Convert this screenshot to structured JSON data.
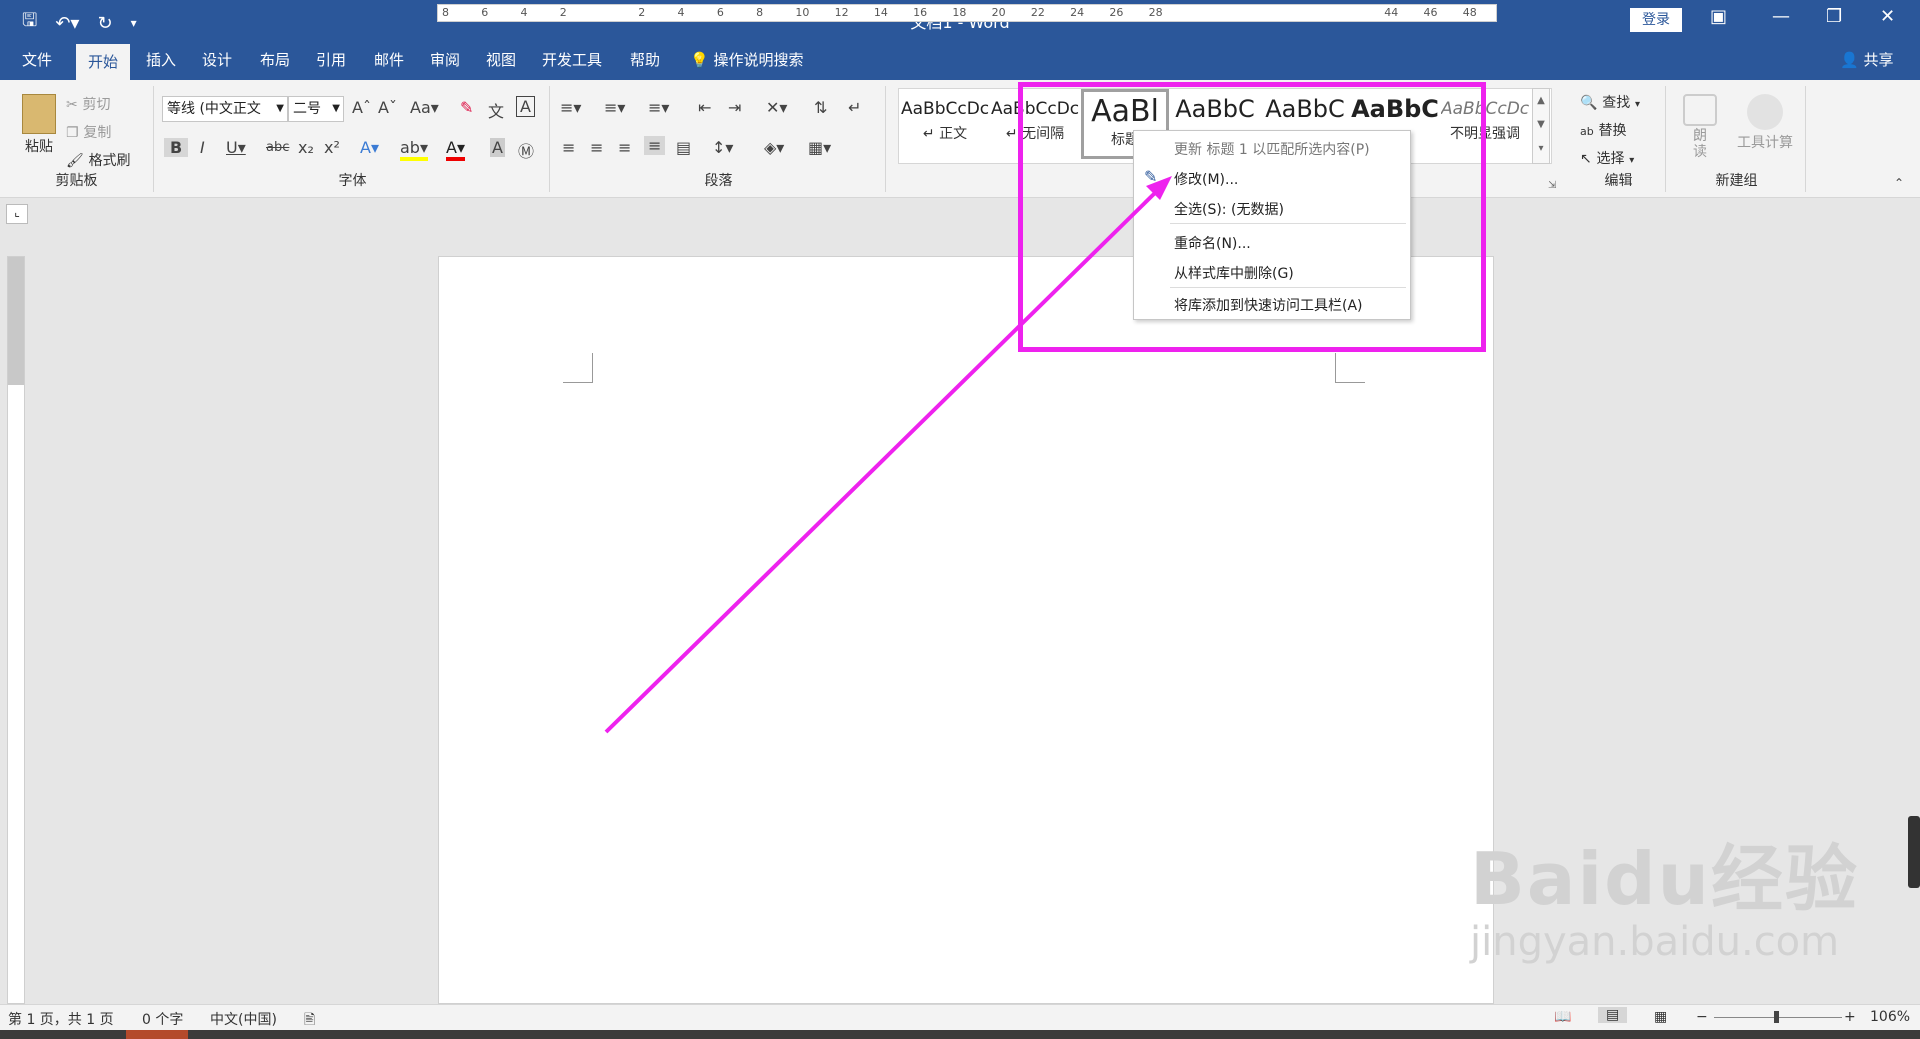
{
  "titlebar": {
    "title": "文档1  -  Word",
    "login": "登录"
  },
  "tabs": [
    "文件",
    "开始",
    "插入",
    "设计",
    "布局",
    "引用",
    "邮件",
    "审阅",
    "视图",
    "开发工具",
    "帮助"
  ],
  "search_tab": "操作说明搜索",
  "share": "共享",
  "clipboard": {
    "paste": "粘贴",
    "cut": "剪切",
    "copy": "复制",
    "format_painter": "格式刷",
    "label": "剪贴板"
  },
  "font": {
    "name": "等线 (中文正文",
    "size": "二号",
    "label": "字体"
  },
  "paragraph": {
    "label": "段落"
  },
  "styles": [
    {
      "preview": "AaBbCcDc",
      "name": "↵ 正文"
    },
    {
      "preview": "AaBbCcDc",
      "name": "↵ 无间隔"
    },
    {
      "preview": "AaBl",
      "name": "标题"
    },
    {
      "preview": "AaBbC",
      "name": ""
    },
    {
      "preview": "AaBbC",
      "name": ""
    },
    {
      "preview": "AaBbC",
      "name": "题"
    },
    {
      "preview": "AaBbCcDc",
      "name": "不明显强调"
    }
  ],
  "editing": {
    "find": "查找",
    "replace": "替换",
    "select": "选择",
    "label": "编辑"
  },
  "newgroup": {
    "read": "朗读",
    "calc": "工具计算",
    "label": "新建组"
  },
  "ruler": {
    "labels": [
      "8",
      "6",
      "4",
      "2",
      "",
      "2",
      "4",
      "6",
      "8",
      "10",
      "12",
      "14",
      "16",
      "18",
      "20",
      "22",
      "24",
      "26",
      "28",
      "",
      "",
      "",
      "",
      "",
      "44",
      "46",
      "48"
    ]
  },
  "context_menu": {
    "items": [
      "更新 标题 1 以匹配所选内容(P)",
      "修改(M)...",
      "全选(S): (无数据)",
      "重命名(N)...",
      "从样式库中删除(G)",
      "将库添加到快速访问工具栏(A)"
    ]
  },
  "status": {
    "page": "第 1 页，共 1 页",
    "words": "0 个字",
    "lang": "中文(中国)",
    "zoom": "106%"
  },
  "watermark": {
    "brand": "Baidu经验",
    "url": "jingyan.baidu.com"
  },
  "colors": {
    "accent": "#2b579a",
    "highlight": "#ee22ee"
  }
}
